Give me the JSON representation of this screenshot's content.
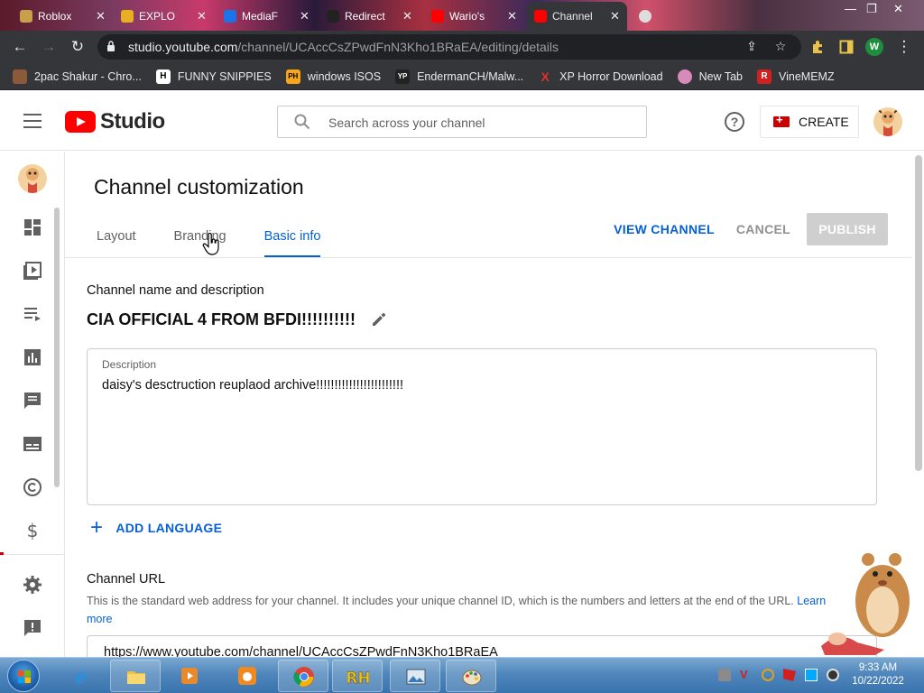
{
  "browser": {
    "tabs": [
      {
        "title": "Roblox"
      },
      {
        "title": "EXPLO"
      },
      {
        "title": "MediaF"
      },
      {
        "title": "Redirect"
      },
      {
        "title": "Wario's"
      },
      {
        "title": "Channel"
      }
    ],
    "url_host": "studio.youtube.com",
    "url_path": "/channel/UCAccCsZPwdFnN3Kho1BRaEA/editing/details",
    "profile_initial": "W",
    "bookmarks": [
      {
        "label": "2pac Shakur - Chro...",
        "icon": "2pac-icon"
      },
      {
        "label": "FUNNY SNIPPIES",
        "icon": "h-icon",
        "glyph": "H"
      },
      {
        "label": "windows ISOS",
        "icon": "ph-icon",
        "glyph": "PH"
      },
      {
        "label": "EndermanCH/Malw...",
        "icon": "yp-icon",
        "glyph": "YP"
      },
      {
        "label": "XP Horror Download",
        "icon": "x-icon",
        "glyph": "X"
      },
      {
        "label": "New Tab",
        "icon": "newtab-icon"
      },
      {
        "label": "VineMEMZ",
        "icon": "r-icon",
        "glyph": "R"
      }
    ]
  },
  "studio": {
    "logo_text": "Studio",
    "search_placeholder": "Search across your channel",
    "create_label": "CREATE"
  },
  "page": {
    "title": "Channel customization",
    "tabs": [
      {
        "label": "Layout",
        "active": false
      },
      {
        "label": "Branding",
        "active": false
      },
      {
        "label": "Basic info",
        "active": true
      }
    ],
    "view_channel": "VIEW CHANNEL",
    "cancel": "CANCEL",
    "publish": "PUBLISH",
    "name_section_heading": "Channel name and description",
    "channel_name": "CIA OFFICIAL 4 FROM BFDI!!!!!!!!!!",
    "description_label": "Description",
    "description_value": "daisy's desctruction reuplaod archive!!!!!!!!!!!!!!!!!!!!!!!!",
    "add_language": "ADD LANGUAGE",
    "url_section_heading": "Channel URL",
    "url_section_desc": "This is the standard web address for your channel. It includes your unique channel ID, which is the numbers and letters at the end of the URL.",
    "learn_more": "Learn more",
    "channel_url": "https://www.youtube.com/channel/UCAccCsZPwdFnN3Kho1BRaEA"
  },
  "taskbar": {
    "time": "9:33 AM",
    "date": "10/22/2022"
  },
  "colors": {
    "accent_blue": "#065fd4",
    "youtube_red": "#ff0000",
    "taskbar_blue": "#4f86bc"
  }
}
